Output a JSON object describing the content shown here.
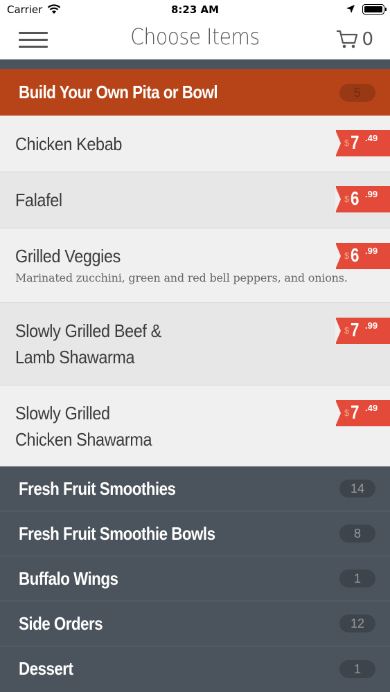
{
  "status": {
    "carrier": "Carrier",
    "time": "8:23 AM"
  },
  "nav": {
    "title": "Choose Items",
    "cart_count": "0"
  },
  "open_category": {
    "label": "Build Your Own Pita or Bowl",
    "count": "5"
  },
  "items": [
    {
      "name": "Chicken Kebab",
      "desc": "",
      "currency": "$",
      "price_whole": "7",
      "price_cents": ".49"
    },
    {
      "name": "Falafel",
      "desc": "",
      "currency": "$",
      "price_whole": "6",
      "price_cents": ".99"
    },
    {
      "name": "Grilled Veggies",
      "desc": "Marinated zucchini, green and red bell peppers, and onions.",
      "currency": "$",
      "price_whole": "6",
      "price_cents": ".99"
    },
    {
      "name_line1": "Slowly Grilled Beef &",
      "name_line2": "Lamb Shawarma",
      "currency": "$",
      "price_whole": "7",
      "price_cents": ".99"
    },
    {
      "name_line1": "Slowly Grilled",
      "name_line2": "Chicken Shawarma",
      "currency": "$",
      "price_whole": "7",
      "price_cents": ".49"
    }
  ],
  "categories": [
    {
      "label": "Fresh Fruit Smoothies",
      "count": "14"
    },
    {
      "label": "Fresh Fruit Smoothie Bowls",
      "count": "8"
    },
    {
      "label": "Buffalo Wings",
      "count": "1"
    },
    {
      "label": "Side Orders",
      "count": "12"
    },
    {
      "label": "Dessert",
      "count": "1"
    }
  ],
  "colors": {
    "accent": "#b74418",
    "price_tag": "#e34a3a",
    "category_bg": "#4b545c"
  }
}
